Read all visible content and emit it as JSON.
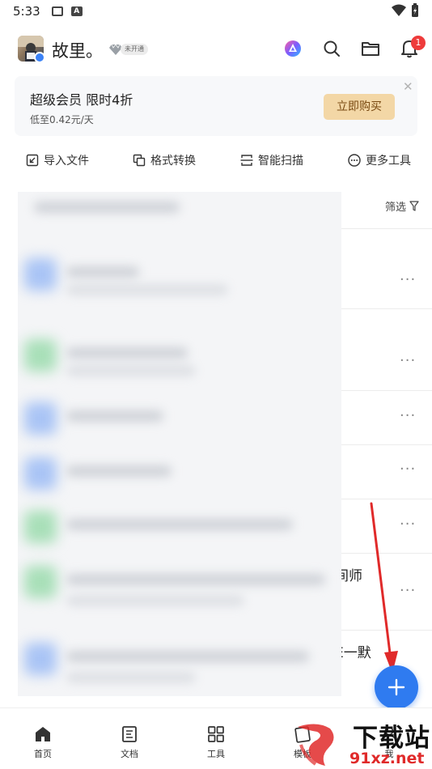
{
  "status_bar": {
    "time": "5:33",
    "sim_icon": "A"
  },
  "header": {
    "user_name": "故里。",
    "vip_status": "未开通",
    "notification_count": "1",
    "icons": [
      "ai-assistant-icon",
      "search-icon",
      "folder-icon",
      "bell-icon"
    ]
  },
  "promo": {
    "title": "超级会员 限时4折",
    "subtitle": "低至0.42元/天",
    "button": "立即购买",
    "close": "✕",
    "button_color": "#f3d7a6"
  },
  "quick_tools": [
    {
      "label": "导入文件",
      "icon": "import-icon"
    },
    {
      "label": "格式转换",
      "icon": "convert-icon"
    },
    {
      "label": "智能扫描",
      "icon": "scan-icon"
    },
    {
      "label": "更多工具",
      "icon": "more-icon"
    }
  ],
  "content": {
    "filter_label": "筛选",
    "peek_text_1": "间师",
    "peek_text_2": "E一默",
    "more_dots": "···"
  },
  "fab": {
    "label": "+",
    "color": "#2f7bf0"
  },
  "bottom_nav": [
    {
      "label": "首页",
      "icon": "home-icon"
    },
    {
      "label": "文档",
      "icon": "document-icon"
    },
    {
      "label": "工具",
      "icon": "tools-grid-icon"
    },
    {
      "label": "模板",
      "icon": "template-icon"
    },
    {
      "label": "我",
      "icon": "profile-icon"
    }
  ],
  "watermark": {
    "title": "下载站",
    "url": "91xz.net"
  },
  "colors": {
    "accent": "#2f7bf0",
    "badge": "#ee3b3b",
    "arrow": "#e02a2a"
  }
}
